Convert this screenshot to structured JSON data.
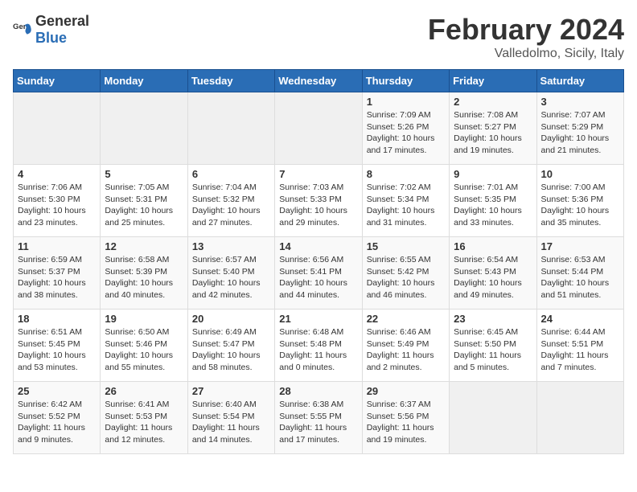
{
  "header": {
    "logo_general": "General",
    "logo_blue": "Blue",
    "title": "February 2024",
    "subtitle": "Valledolmo, Sicily, Italy"
  },
  "weekdays": [
    "Sunday",
    "Monday",
    "Tuesday",
    "Wednesday",
    "Thursday",
    "Friday",
    "Saturday"
  ],
  "weeks": [
    [
      {
        "day": "",
        "info": ""
      },
      {
        "day": "",
        "info": ""
      },
      {
        "day": "",
        "info": ""
      },
      {
        "day": "",
        "info": ""
      },
      {
        "day": "1",
        "info": "Sunrise: 7:09 AM\nSunset: 5:26 PM\nDaylight: 10 hours\nand 17 minutes."
      },
      {
        "day": "2",
        "info": "Sunrise: 7:08 AM\nSunset: 5:27 PM\nDaylight: 10 hours\nand 19 minutes."
      },
      {
        "day": "3",
        "info": "Sunrise: 7:07 AM\nSunset: 5:29 PM\nDaylight: 10 hours\nand 21 minutes."
      }
    ],
    [
      {
        "day": "4",
        "info": "Sunrise: 7:06 AM\nSunset: 5:30 PM\nDaylight: 10 hours\nand 23 minutes."
      },
      {
        "day": "5",
        "info": "Sunrise: 7:05 AM\nSunset: 5:31 PM\nDaylight: 10 hours\nand 25 minutes."
      },
      {
        "day": "6",
        "info": "Sunrise: 7:04 AM\nSunset: 5:32 PM\nDaylight: 10 hours\nand 27 minutes."
      },
      {
        "day": "7",
        "info": "Sunrise: 7:03 AM\nSunset: 5:33 PM\nDaylight: 10 hours\nand 29 minutes."
      },
      {
        "day": "8",
        "info": "Sunrise: 7:02 AM\nSunset: 5:34 PM\nDaylight: 10 hours\nand 31 minutes."
      },
      {
        "day": "9",
        "info": "Sunrise: 7:01 AM\nSunset: 5:35 PM\nDaylight: 10 hours\nand 33 minutes."
      },
      {
        "day": "10",
        "info": "Sunrise: 7:00 AM\nSunset: 5:36 PM\nDaylight: 10 hours\nand 35 minutes."
      }
    ],
    [
      {
        "day": "11",
        "info": "Sunrise: 6:59 AM\nSunset: 5:37 PM\nDaylight: 10 hours\nand 38 minutes."
      },
      {
        "day": "12",
        "info": "Sunrise: 6:58 AM\nSunset: 5:39 PM\nDaylight: 10 hours\nand 40 minutes."
      },
      {
        "day": "13",
        "info": "Sunrise: 6:57 AM\nSunset: 5:40 PM\nDaylight: 10 hours\nand 42 minutes."
      },
      {
        "day": "14",
        "info": "Sunrise: 6:56 AM\nSunset: 5:41 PM\nDaylight: 10 hours\nand 44 minutes."
      },
      {
        "day": "15",
        "info": "Sunrise: 6:55 AM\nSunset: 5:42 PM\nDaylight: 10 hours\nand 46 minutes."
      },
      {
        "day": "16",
        "info": "Sunrise: 6:54 AM\nSunset: 5:43 PM\nDaylight: 10 hours\nand 49 minutes."
      },
      {
        "day": "17",
        "info": "Sunrise: 6:53 AM\nSunset: 5:44 PM\nDaylight: 10 hours\nand 51 minutes."
      }
    ],
    [
      {
        "day": "18",
        "info": "Sunrise: 6:51 AM\nSunset: 5:45 PM\nDaylight: 10 hours\nand 53 minutes."
      },
      {
        "day": "19",
        "info": "Sunrise: 6:50 AM\nSunset: 5:46 PM\nDaylight: 10 hours\nand 55 minutes."
      },
      {
        "day": "20",
        "info": "Sunrise: 6:49 AM\nSunset: 5:47 PM\nDaylight: 10 hours\nand 58 minutes."
      },
      {
        "day": "21",
        "info": "Sunrise: 6:48 AM\nSunset: 5:48 PM\nDaylight: 11 hours\nand 0 minutes."
      },
      {
        "day": "22",
        "info": "Sunrise: 6:46 AM\nSunset: 5:49 PM\nDaylight: 11 hours\nand 2 minutes."
      },
      {
        "day": "23",
        "info": "Sunrise: 6:45 AM\nSunset: 5:50 PM\nDaylight: 11 hours\nand 5 minutes."
      },
      {
        "day": "24",
        "info": "Sunrise: 6:44 AM\nSunset: 5:51 PM\nDaylight: 11 hours\nand 7 minutes."
      }
    ],
    [
      {
        "day": "25",
        "info": "Sunrise: 6:42 AM\nSunset: 5:52 PM\nDaylight: 11 hours\nand 9 minutes."
      },
      {
        "day": "26",
        "info": "Sunrise: 6:41 AM\nSunset: 5:53 PM\nDaylight: 11 hours\nand 12 minutes."
      },
      {
        "day": "27",
        "info": "Sunrise: 6:40 AM\nSunset: 5:54 PM\nDaylight: 11 hours\nand 14 minutes."
      },
      {
        "day": "28",
        "info": "Sunrise: 6:38 AM\nSunset: 5:55 PM\nDaylight: 11 hours\nand 17 minutes."
      },
      {
        "day": "29",
        "info": "Sunrise: 6:37 AM\nSunset: 5:56 PM\nDaylight: 11 hours\nand 19 minutes."
      },
      {
        "day": "",
        "info": ""
      },
      {
        "day": "",
        "info": ""
      }
    ]
  ]
}
